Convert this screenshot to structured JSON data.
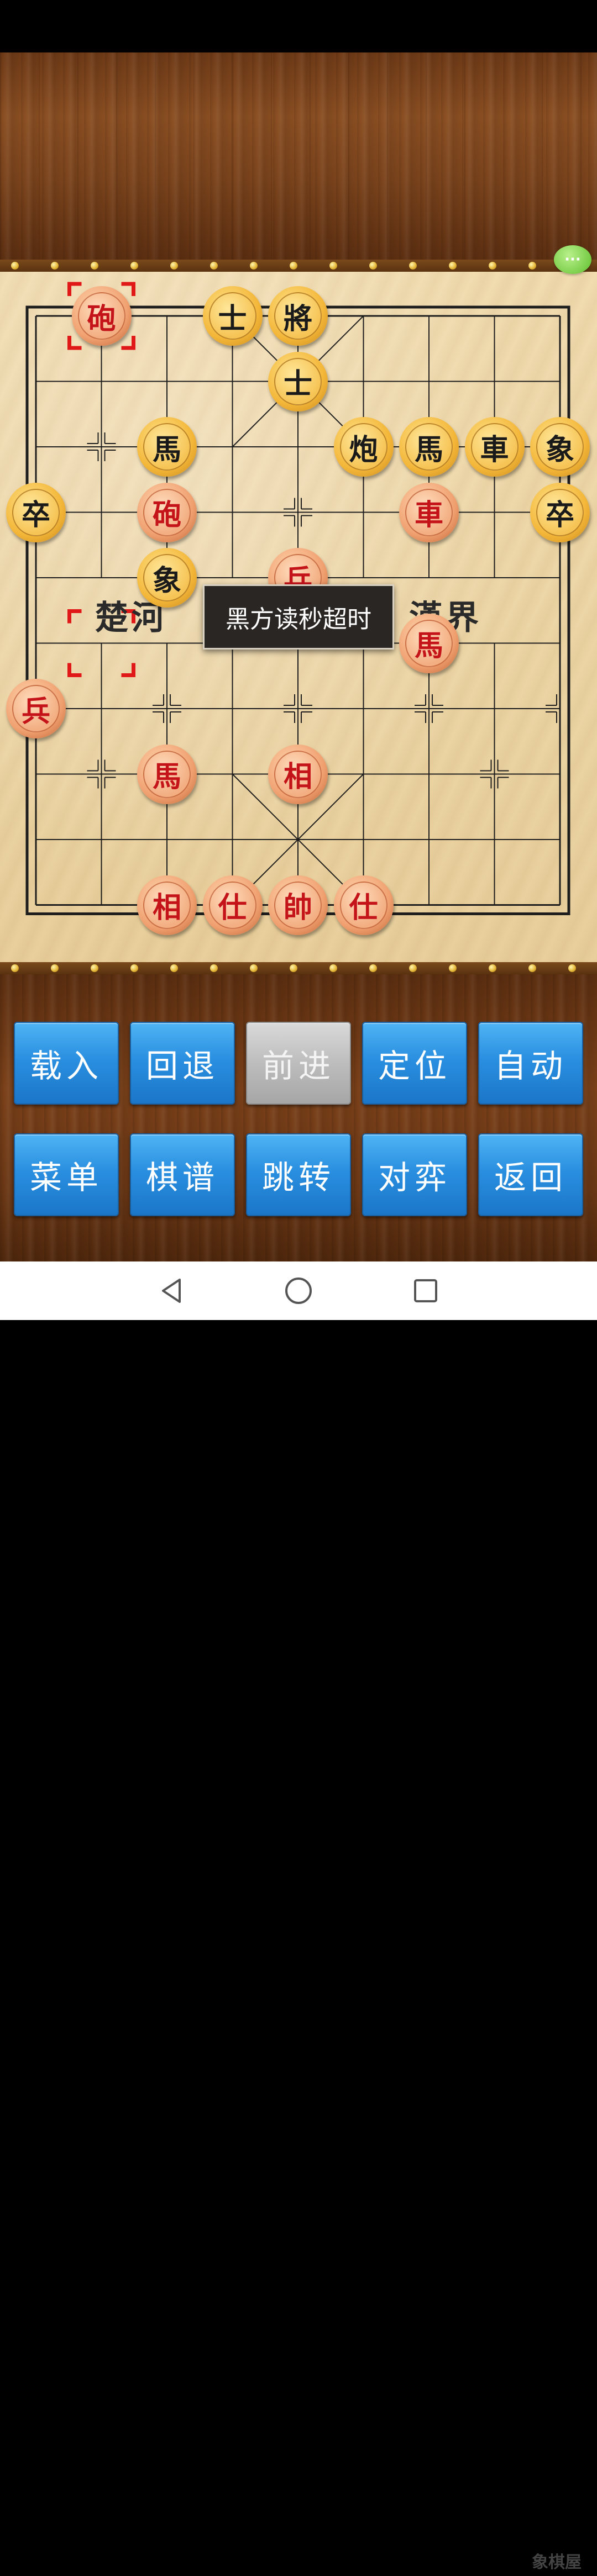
{
  "board": {
    "river_left": "楚河",
    "river_right": "漢界",
    "pieces": [
      {
        "label": "砲",
        "side": "red",
        "col": 1,
        "row": 0
      },
      {
        "label": "士",
        "side": "black",
        "col": 3,
        "row": 0
      },
      {
        "label": "將",
        "side": "black",
        "col": 4,
        "row": 0
      },
      {
        "label": "士",
        "side": "black",
        "col": 4,
        "row": 1
      },
      {
        "label": "馬",
        "side": "black",
        "col": 2,
        "row": 2
      },
      {
        "label": "炮",
        "side": "black",
        "col": 5,
        "row": 2
      },
      {
        "label": "馬",
        "side": "black",
        "col": 6,
        "row": 2
      },
      {
        "label": "車",
        "side": "black",
        "col": 7,
        "row": 2
      },
      {
        "label": "象",
        "side": "black",
        "col": 8,
        "row": 2
      },
      {
        "label": "卒",
        "side": "black",
        "col": 0,
        "row": 3
      },
      {
        "label": "砲",
        "side": "red",
        "col": 2,
        "row": 3
      },
      {
        "label": "車",
        "side": "red",
        "col": 6,
        "row": 3
      },
      {
        "label": "卒",
        "side": "black",
        "col": 8,
        "row": 3
      },
      {
        "label": "象",
        "side": "black",
        "col": 2,
        "row": 4
      },
      {
        "label": "兵",
        "side": "red",
        "col": 4,
        "row": 4
      },
      {
        "label": "馬",
        "side": "red",
        "col": 6,
        "row": 5
      },
      {
        "label": "兵",
        "side": "red",
        "col": 0,
        "row": 6
      },
      {
        "label": "馬",
        "side": "red",
        "col": 2,
        "row": 7
      },
      {
        "label": "相",
        "side": "red",
        "col": 4,
        "row": 7
      },
      {
        "label": "相",
        "side": "red",
        "col": 2,
        "row": 9
      },
      {
        "label": "仕",
        "side": "red",
        "col": 3,
        "row": 9
      },
      {
        "label": "帥",
        "side": "red",
        "col": 4,
        "row": 9
      },
      {
        "label": "仕",
        "side": "red",
        "col": 5,
        "row": 9
      }
    ],
    "selection_markers": [
      {
        "col": 1,
        "row": 0
      },
      {
        "col": 1,
        "row": 5
      }
    ]
  },
  "toast": "黑方读秒超时",
  "chat_icon": "chat-bubble-icon",
  "buttons_row1": [
    {
      "label": "载入",
      "enabled": true
    },
    {
      "label": "回退",
      "enabled": true
    },
    {
      "label": "前进",
      "enabled": false
    },
    {
      "label": "定位",
      "enabled": true
    },
    {
      "label": "自动",
      "enabled": true
    }
  ],
  "buttons_row2": [
    {
      "label": "菜单",
      "enabled": true
    },
    {
      "label": "棋谱",
      "enabled": true
    },
    {
      "label": "跳转",
      "enabled": true
    },
    {
      "label": "对弈",
      "enabled": true
    },
    {
      "label": "返回",
      "enabled": true
    }
  ],
  "nav": {
    "back_icon": "back-triangle-icon",
    "home_icon": "home-circle-icon",
    "recents_icon": "recents-square-icon"
  },
  "watermark": "象棋屋"
}
